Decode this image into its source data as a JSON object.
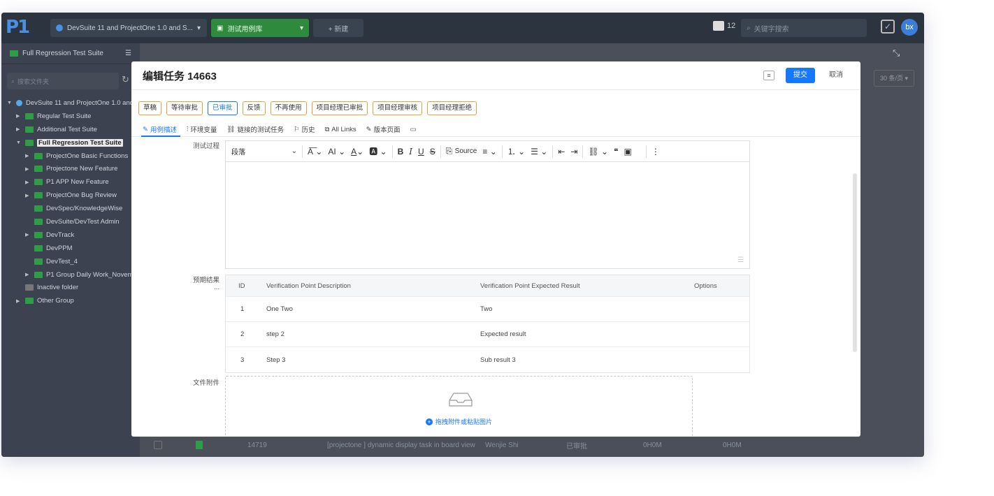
{
  "topbar": {
    "project_label": "DevSuite 11 and ProjectOne 1.0 and S...",
    "repo_label": "测试用例库",
    "new_label": "+ 新建",
    "calendar_count": "12",
    "search_placeholder": "关键字搜索"
  },
  "user": {
    "initials": "bx"
  },
  "sidebar": {
    "suite_title": "Full Regression Test Suite",
    "search_placeholder": "搜索文件夹",
    "tree": [
      {
        "label": "DevSuite 11 and ProjectOne 1.0 and",
        "level": 0,
        "arrow": "down",
        "icon": "globe"
      },
      {
        "label": "Regular Test Suite",
        "level": 1,
        "arrow": "right",
        "icon": "folder"
      },
      {
        "label": "Additional Test Suite",
        "level": 1,
        "arrow": "right",
        "icon": "folder"
      },
      {
        "label": "Full Regression Test Suite",
        "level": 1,
        "arrow": "down",
        "icon": "folder",
        "selected": true
      },
      {
        "label": "ProjectOne Basic Functions",
        "level": 2,
        "arrow": "right",
        "icon": "folder"
      },
      {
        "label": "Projectone New Feature",
        "level": 2,
        "arrow": "right",
        "icon": "folder"
      },
      {
        "label": "P1 APP New Feature",
        "level": 2,
        "arrow": "right",
        "icon": "folder"
      },
      {
        "label": "ProjectOne Bug Review",
        "level": 2,
        "arrow": "right",
        "icon": "folder"
      },
      {
        "label": "DevSpec/KnowledgeWise",
        "level": 2,
        "arrow": "none",
        "icon": "folder"
      },
      {
        "label": "DevSuite/DevTest Admin",
        "level": 2,
        "arrow": "none",
        "icon": "folder"
      },
      {
        "label": "DevTrack",
        "level": 2,
        "arrow": "right",
        "icon": "folder"
      },
      {
        "label": "DevPPM",
        "level": 2,
        "arrow": "none",
        "icon": "folder"
      },
      {
        "label": "DevTest_4",
        "level": 2,
        "arrow": "none",
        "icon": "folder"
      },
      {
        "label": "P1 Group Daily Work_Novem",
        "level": 2,
        "arrow": "right",
        "icon": "folder"
      },
      {
        "label": "Inactive folder",
        "level": 1,
        "arrow": "none",
        "icon": "grey"
      },
      {
        "label": "Other Group",
        "level": 1,
        "arrow": "right",
        "icon": "folder"
      }
    ]
  },
  "background": {
    "per_page": "30 条/页",
    "row": {
      "id": "14719",
      "title": "[projectone ] dynamic display task in board view",
      "owner": "Wenjie Shi",
      "status": "已审批",
      "est": "0H0M",
      "spent": "0H0M"
    }
  },
  "modal": {
    "title": "编辑任务 14663",
    "submit_label": "提交",
    "cancel_label": "取消",
    "statuses": [
      {
        "label": "草稿",
        "active": false
      },
      {
        "label": "等待审批",
        "active": false
      },
      {
        "label": "已审批",
        "active": true
      },
      {
        "label": "反馈",
        "active": false
      },
      {
        "label": "不再使用",
        "active": false
      },
      {
        "label": "项目经理已审批",
        "active": false
      },
      {
        "label": "项目经理审核",
        "active": false
      },
      {
        "label": "项目经理拒绝",
        "active": false
      }
    ],
    "tabs": [
      {
        "label": "用例描述",
        "icon": "edit-icon",
        "active": true
      },
      {
        "label": "环境变量",
        "icon": "sliders-icon",
        "active": false
      },
      {
        "label": "链接的测试任务",
        "icon": "link-icon",
        "active": false
      },
      {
        "label": "历史",
        "icon": "flag-icon",
        "active": false
      },
      {
        "label": "All Links",
        "icon": "links-icon",
        "active": false
      },
      {
        "label": "版本页面",
        "icon": "edit-icon",
        "active": false
      },
      {
        "label": "",
        "icon": "video-icon",
        "active": false
      }
    ],
    "test_process_label": "测试过程",
    "expected_label": "预期结果",
    "expected_sub": "...",
    "attach_label": "文件附件",
    "editor": {
      "paragraph_label": "段落",
      "source_label": "Source"
    },
    "table": {
      "headers": [
        "ID",
        "Verification Point Description",
        "Verification Point Expected Result",
        "Options"
      ],
      "rows": [
        {
          "id": "1",
          "desc": "One Two",
          "result": "Two"
        },
        {
          "id": "2",
          "desc": "step 2",
          "result": "Expected result"
        },
        {
          "id": "3",
          "desc": "Step 3",
          "result": "Sub result 3"
        }
      ]
    },
    "attach_text": "拖拽附件或粘贴图片"
  }
}
